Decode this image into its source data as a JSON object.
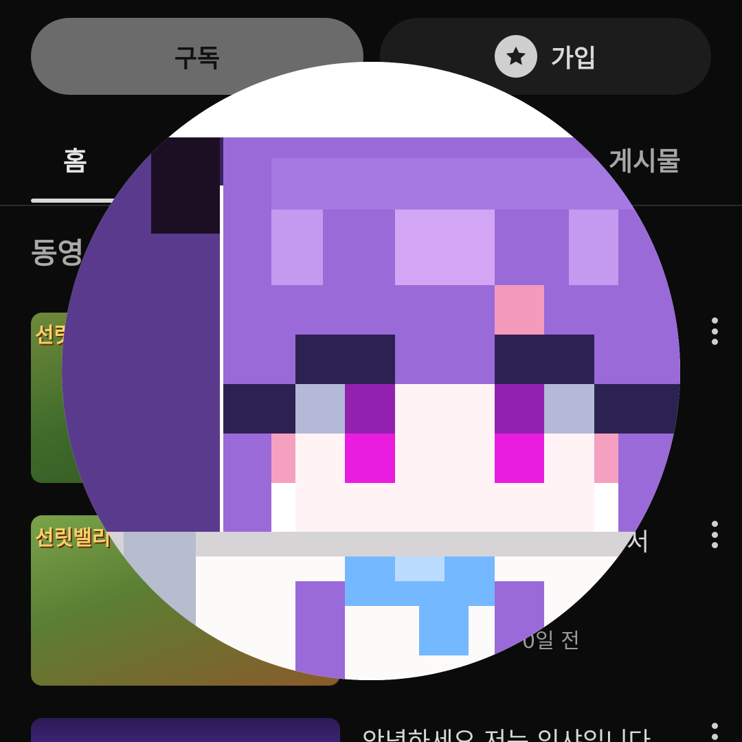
{
  "actions": {
    "subscribe_label": "구독",
    "join_label": "가입"
  },
  "tabs": {
    "home": "홈",
    "posts": "게시물"
  },
  "section": {
    "title": "동영"
  },
  "videos": [
    {
      "thumb_label": "선릿"
    },
    {
      "thumb_label": "선릿밸리",
      "title": "서",
      "meta": "0일 전"
    },
    {
      "title": "안녕하세요 저는 익샤입니다"
    }
  ],
  "colors": {
    "background": "#0b0b0b",
    "subscribe_button": "#6b6b6b",
    "join_button": "#1c1c1c",
    "avatar_hair": "#9a6ad8",
    "avatar_eye": "#e81de0",
    "avatar_bow": "#74b8ff"
  },
  "icons": {
    "join": "star-icon",
    "more": "more-vertical-icon"
  }
}
